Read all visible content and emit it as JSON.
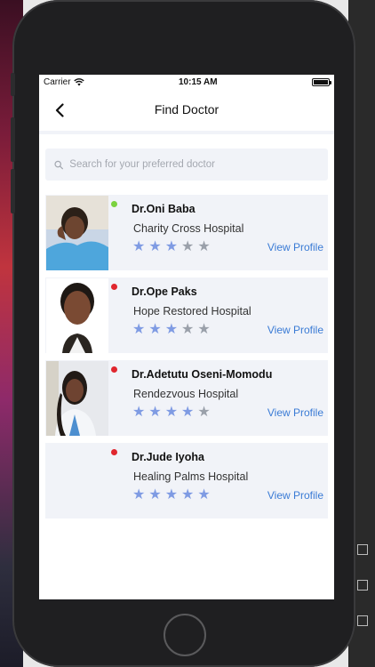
{
  "statusbar": {
    "carrier": "Carrier",
    "time": "10:15 AM"
  },
  "nav": {
    "title": "Find Doctor"
  },
  "search": {
    "placeholder": "Search for your preferred doctor"
  },
  "doctors": [
    {
      "name": "Dr.Oni Baba",
      "hospital": "Charity Cross Hospital",
      "online": true,
      "rating": 3,
      "action": "View Profile"
    },
    {
      "name": "Dr.Ope Paks",
      "hospital": "Hope Restored Hospital",
      "online": false,
      "rating": 3,
      "action": "View Profile"
    },
    {
      "name": "Dr.Adetutu Oseni-Momodu",
      "hospital": "Rendezvous Hospital",
      "online": false,
      "rating": 4,
      "action": "View Profile"
    },
    {
      "name": "Dr.Jude Iyoha",
      "hospital": "Healing Palms Hospital",
      "online": false,
      "rating": 5,
      "action": "View Profile"
    }
  ],
  "rating_max": 5,
  "colors": {
    "online": "#7bd23f",
    "offline": "#e0262e",
    "star_on": "#7f9be3",
    "star_off": "#9aa0aa",
    "link": "#3a7bd5"
  }
}
